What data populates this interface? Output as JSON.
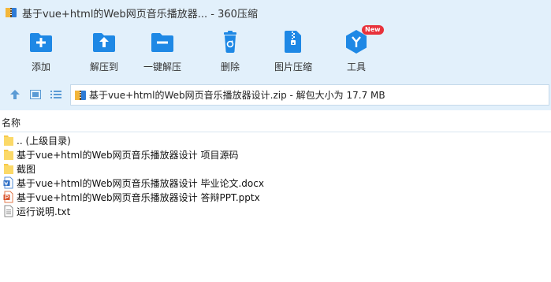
{
  "window": {
    "title": "基于vue+html的Web网页音乐播放器... - 360压缩"
  },
  "toolbar": {
    "items": [
      {
        "label": "添加",
        "icon": "add-icon"
      },
      {
        "label": "解压到",
        "icon": "extract-to-icon"
      },
      {
        "label": "一键解压",
        "icon": "one-click-extract-icon"
      },
      {
        "label": "删除",
        "icon": "delete-icon"
      },
      {
        "label": "图片压缩",
        "icon": "image-compress-icon"
      },
      {
        "label": "工具",
        "icon": "tools-icon"
      }
    ],
    "tools_badge": "New"
  },
  "addressbar": {
    "path": "基于vue+html的Web网页音乐播放器设计.zip - 解包大小为 17.7 MB"
  },
  "filelist": {
    "column_name": "名称",
    "items": [
      {
        "name": ".. (上级目录)",
        "icon": "folder-icon"
      },
      {
        "name": "基于vue+html的Web网页音乐播放器设计 项目源码",
        "icon": "folder-icon"
      },
      {
        "name": "截图",
        "icon": "folder-icon"
      },
      {
        "name": "基于vue+html的Web网页音乐播放器设计 毕业论文.docx",
        "icon": "word-doc-icon"
      },
      {
        "name": "基于vue+html的Web网页音乐播放器设计 答辩PPT.pptx",
        "icon": "powerpoint-icon"
      },
      {
        "name": "运行说明.txt",
        "icon": "text-file-icon"
      }
    ]
  },
  "colors": {
    "toolbar_bg": "#e2f0fb",
    "icon_blue": "#1e88e5",
    "badge_red": "#e8323b",
    "folder_yellow": "#f7c948"
  }
}
